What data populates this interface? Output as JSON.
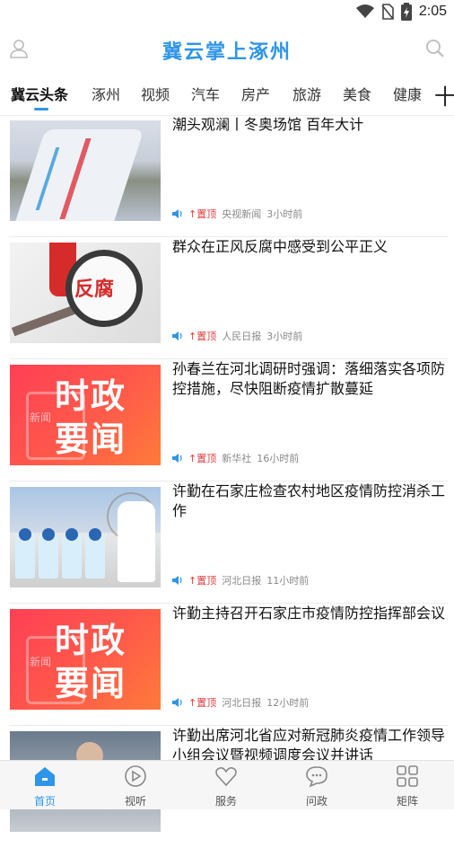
{
  "status_bar": {
    "time": "2:05"
  },
  "app": {
    "title": "冀云掌上涿州"
  },
  "tabs": [
    "冀云头条",
    "涿州",
    "视频",
    "汽车",
    "房产",
    "旅游",
    "美食",
    "健康"
  ],
  "tabs_more_symbol": "十",
  "news": [
    {
      "title": "潮头观澜丨冬奥场馆 百年大计",
      "pin": "置顶",
      "source": "央视新闻",
      "time": "3小时前"
    },
    {
      "title": "群众在正风反腐中感受到公平正义",
      "pin": "置顶",
      "source": "人民日报",
      "time": "3小时前",
      "thumb_text": "反腐"
    },
    {
      "title": "孙春兰在河北调研时强调：落细落实各项防控措施，尽快阻断疫情扩散蔓延",
      "pin": "置顶",
      "source": "新华社",
      "time": "16小时前",
      "thumb_text": [
        "时政",
        "要闻",
        "新闻"
      ]
    },
    {
      "title": "许勤在石家庄检查农村地区疫情防控消杀工作",
      "pin": "置顶",
      "source": "河北日报",
      "time": "11小时前"
    },
    {
      "title": "许勤主持召开石家庄市疫情防控指挥部会议",
      "pin": "置顶",
      "source": "河北日报",
      "time": "12小时前",
      "thumb_text": [
        "时政",
        "要闻",
        "新闻"
      ]
    },
    {
      "title": "许勤出席河北省应对新冠肺炎疫情工作领导小组会议暨视频调度会议并讲话"
    }
  ],
  "bottom_nav": [
    {
      "label": "首页",
      "icon": "home-icon",
      "active": true
    },
    {
      "label": "视听",
      "icon": "play-icon"
    },
    {
      "label": "服务",
      "icon": "heart-icon"
    },
    {
      "label": "问政",
      "icon": "chat-icon"
    },
    {
      "label": "矩阵",
      "icon": "grid-icon"
    }
  ],
  "colors": {
    "accent": "#2f95e8",
    "pin": "#e23b3b"
  }
}
